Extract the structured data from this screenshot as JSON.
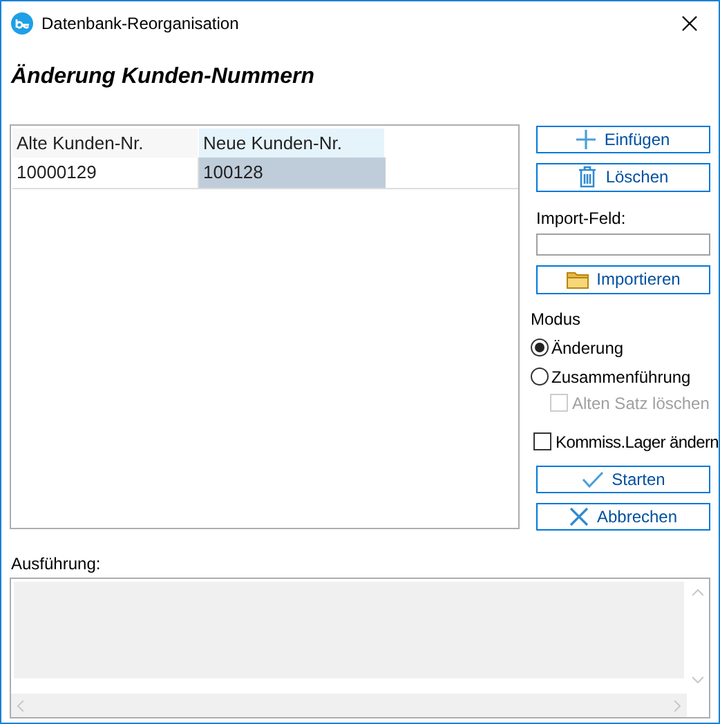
{
  "window": {
    "title": "Datenbank-Reorganisation"
  },
  "heading": "Änderung Kunden-Nummern",
  "table": {
    "columns": [
      {
        "label": "Alte Kunden-Nr.",
        "selected": false
      },
      {
        "label": "Neue Kunden-Nr.",
        "selected": true
      }
    ],
    "rows": [
      {
        "cells": [
          {
            "text": "10000129",
            "selected": false
          },
          {
            "text": "100128",
            "selected": true
          }
        ]
      }
    ]
  },
  "buttons_top": [
    {
      "label": "Einfügen",
      "kind": "plus"
    },
    {
      "label": "Löschen",
      "kind": "trash"
    }
  ],
  "import_field": {
    "label": "Import-Feld:"
  },
  "import_button": {
    "label": "Importieren",
    "kind": "folder"
  },
  "modus": {
    "label": "Modus",
    "options": [
      {
        "label": "Änderung",
        "selected": true
      },
      {
        "label": "Zusammenführung",
        "selected": false
      }
    ],
    "sub_option": {
      "label": "Alten Satz löschen",
      "checked": false,
      "disabled": true
    }
  },
  "lager_checkbox": {
    "label": "Kommiss.Lager ändern",
    "checked": false,
    "disabled": false
  },
  "buttons_bottom": [
    {
      "label": "Starten",
      "kind": "check"
    },
    {
      "label": "Abbrechen",
      "kind": "cross"
    }
  ],
  "output": {
    "label": "Ausführung:"
  }
}
